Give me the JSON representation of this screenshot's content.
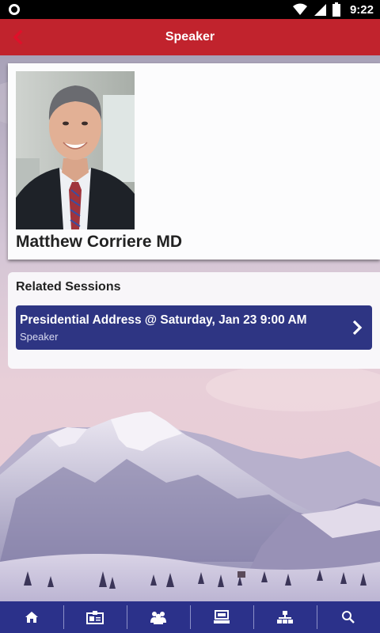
{
  "status_bar": {
    "time": "9:22"
  },
  "app_bar": {
    "title": "Speaker",
    "accent_color": "#c1232d"
  },
  "speaker": {
    "name": "Matthew Corriere MD"
  },
  "related_sessions": {
    "heading": "Related Sessions",
    "items": [
      {
        "title": "Presidential Address @ Saturday, Jan 23 9:00 AM",
        "role": "Speaker"
      }
    ]
  },
  "bottom_nav": {
    "color": "#2b318a",
    "items": [
      {
        "icon": "home-icon"
      },
      {
        "icon": "badge-icon"
      },
      {
        "icon": "people-icon"
      },
      {
        "icon": "exhibitor-icon"
      },
      {
        "icon": "org-chart-icon"
      },
      {
        "icon": "search-icon"
      }
    ]
  }
}
